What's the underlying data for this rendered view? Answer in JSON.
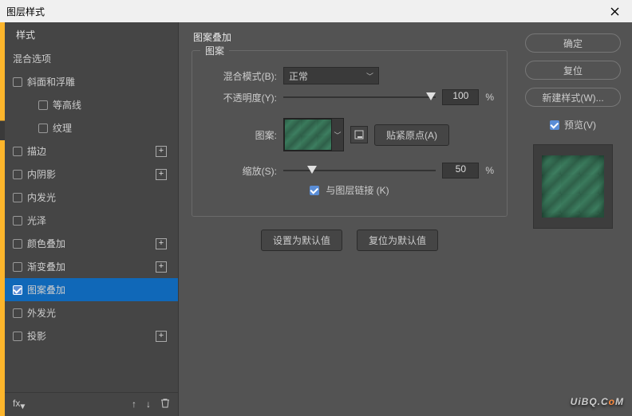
{
  "window": {
    "title": "图层样式"
  },
  "sidebar": {
    "header": "样式",
    "blend_options": "混合选项",
    "items": [
      {
        "label": "斜面和浮雕",
        "checked": false,
        "plus": false,
        "sub": false
      },
      {
        "label": "等高线",
        "checked": false,
        "plus": false,
        "sub": true
      },
      {
        "label": "纹理",
        "checked": false,
        "plus": false,
        "sub": true
      },
      {
        "label": "描边",
        "checked": false,
        "plus": true,
        "sub": false
      },
      {
        "label": "内阴影",
        "checked": false,
        "plus": true,
        "sub": false
      },
      {
        "label": "内发光",
        "checked": false,
        "plus": false,
        "sub": false
      },
      {
        "label": "光泽",
        "checked": false,
        "plus": false,
        "sub": false
      },
      {
        "label": "颜色叠加",
        "checked": false,
        "plus": true,
        "sub": false
      },
      {
        "label": "渐变叠加",
        "checked": false,
        "plus": true,
        "sub": false
      },
      {
        "label": "图案叠加",
        "checked": true,
        "plus": false,
        "sub": false,
        "active": true
      },
      {
        "label": "外发光",
        "checked": false,
        "plus": false,
        "sub": false
      },
      {
        "label": "投影",
        "checked": false,
        "plus": true,
        "sub": false
      }
    ]
  },
  "panel": {
    "title": "图案叠加",
    "group": "图案",
    "blend_mode_label": "混合模式(B):",
    "blend_mode_value": "正常",
    "opacity_label": "不透明度(Y):",
    "opacity_value": "100",
    "percent": "%",
    "pattern_label": "图案:",
    "snap_label": "贴紧原点(A)",
    "scale_label": "缩放(S):",
    "scale_value": "50",
    "link_label": "与图层链接 (K)",
    "defaults_set": "设置为默认值",
    "defaults_reset": "复位为默认值"
  },
  "right": {
    "ok": "确定",
    "cancel": "复位",
    "new_style": "新建样式(W)...",
    "preview": "预览(V)"
  },
  "watermark": {
    "text_a": "UiBQ.C",
    "text_b": "o",
    "text_c": "M"
  }
}
